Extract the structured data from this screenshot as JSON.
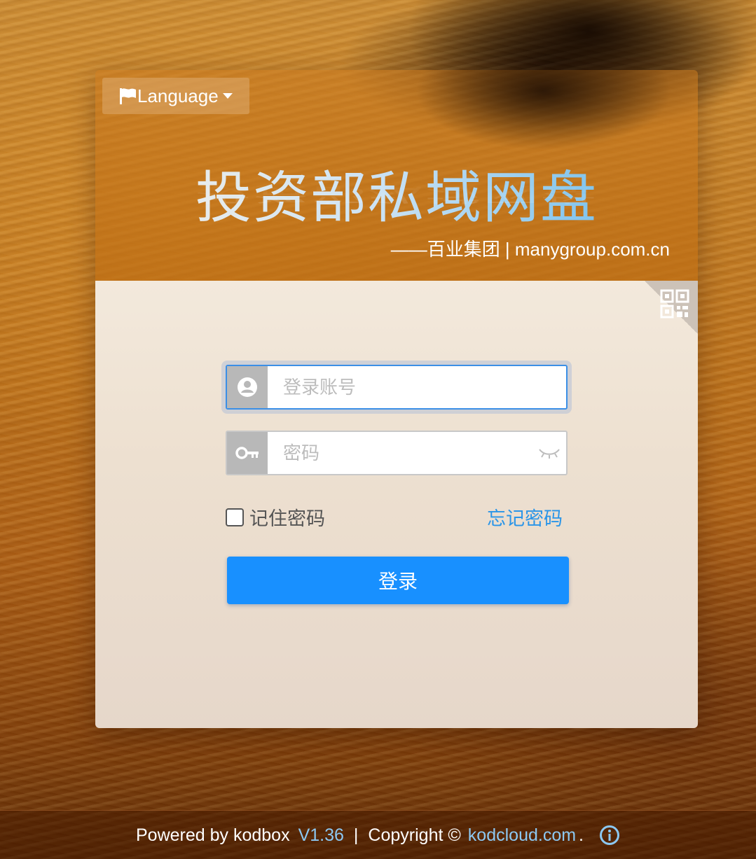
{
  "header": {
    "language_label": "Language",
    "title": "投资部私域网盘",
    "subtitle": "——百业集团 | manygroup.com.cn"
  },
  "login_form": {
    "username_placeholder": "登录账号",
    "password_placeholder": "密码",
    "remember_label": "记住密码",
    "forgot_label": "忘记密码",
    "login_label": "登录"
  },
  "footer": {
    "powered_by": "Powered by kodbox",
    "version": "V1.36",
    "separator": "|",
    "copyright": "Copyright ©",
    "site": "kodcloud.com",
    "dot": "."
  },
  "icons": {
    "language": "flag-icon",
    "qr": "qr-code-icon",
    "user": "user-icon",
    "key": "key-icon",
    "eye": "eye-closed-icon",
    "info": "info-icon"
  },
  "colors": {
    "primary": "#1890ff",
    "link": "#2a95e8",
    "footer_link": "#8cc8f2"
  }
}
